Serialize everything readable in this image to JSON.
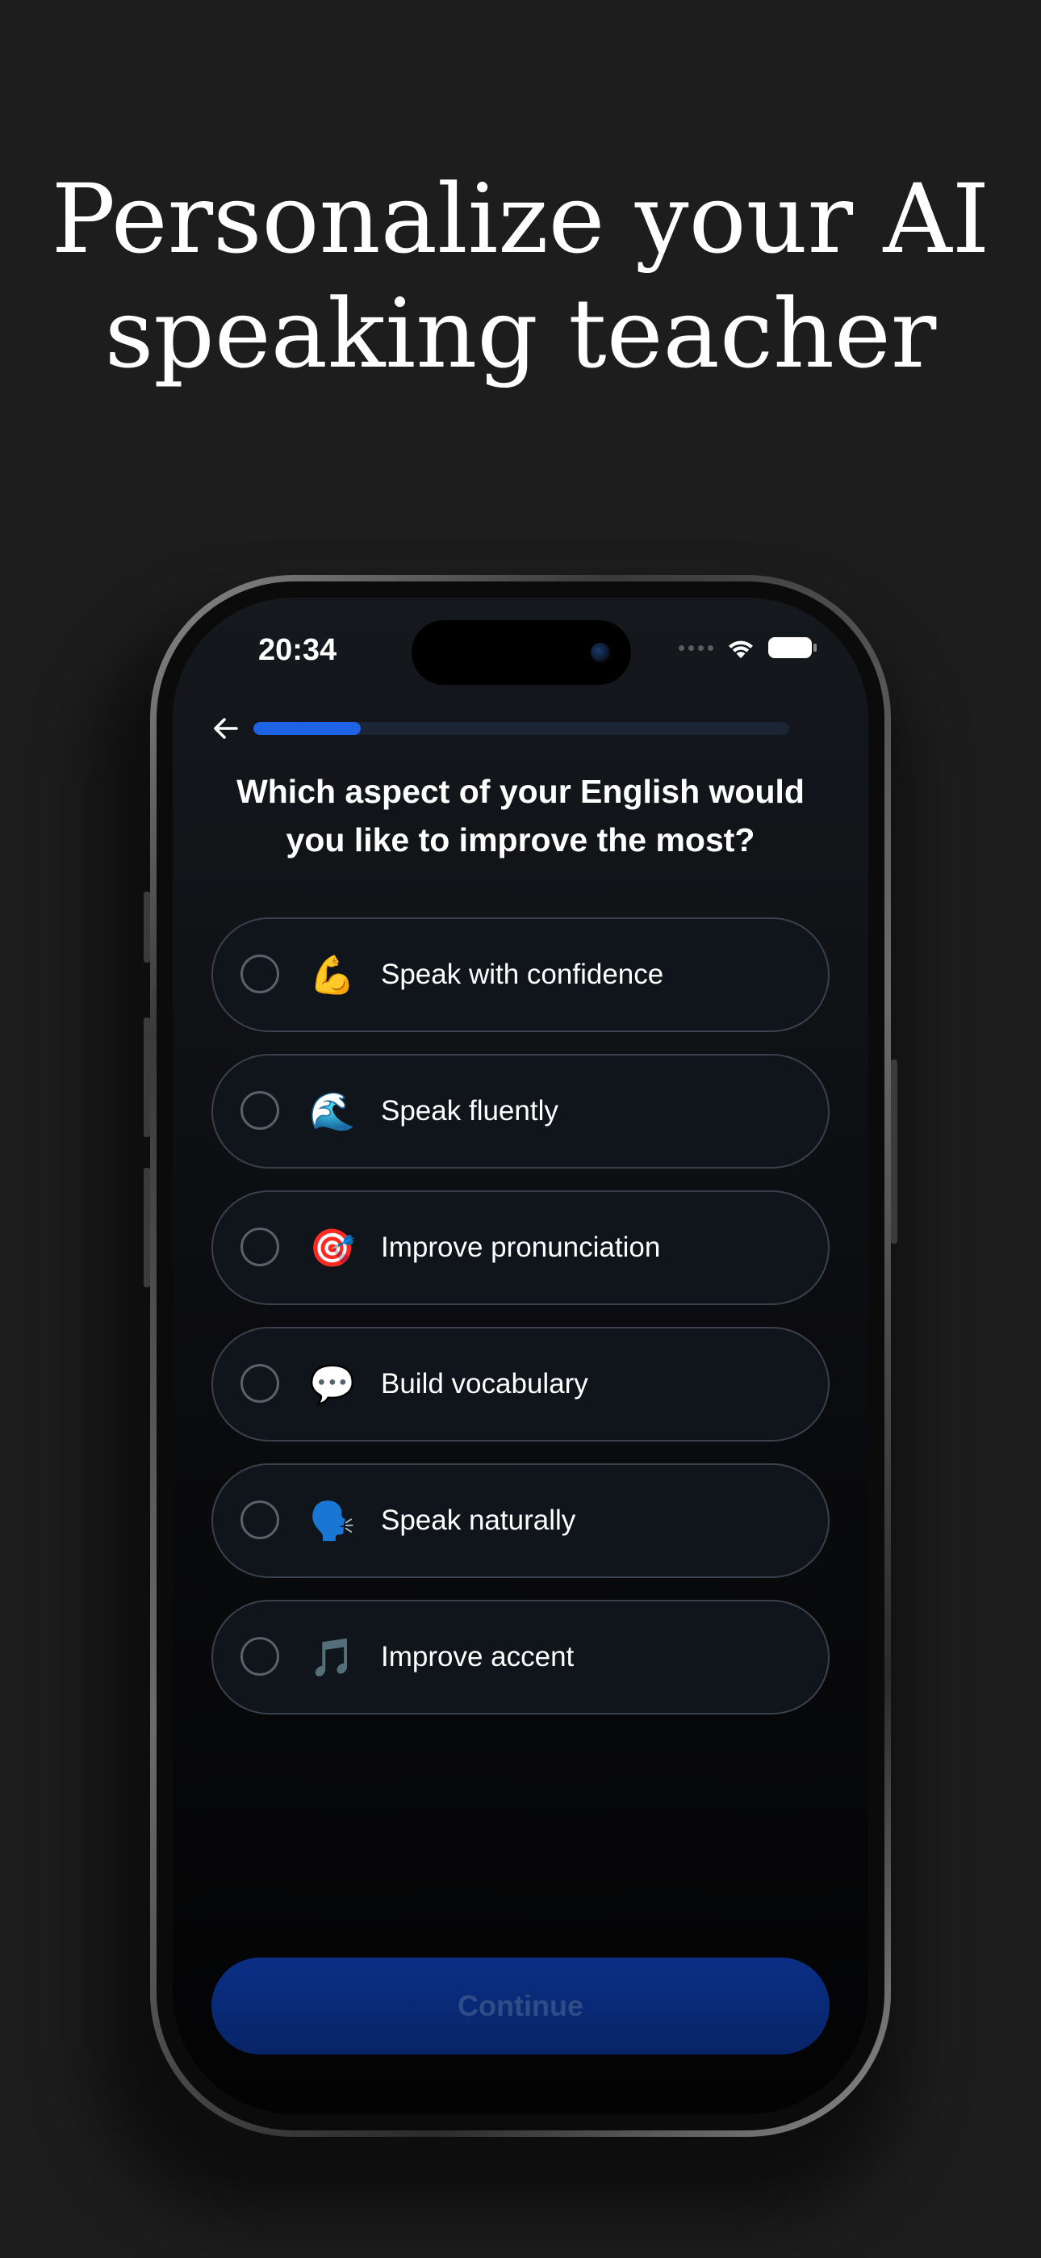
{
  "marketing": {
    "headline_line1": "Personalize your AI",
    "headline_line2": "speaking teacher"
  },
  "status_bar": {
    "time": "20:34",
    "icons": [
      "cellular-signal-icon",
      "wifi-icon",
      "battery-icon"
    ]
  },
  "header": {
    "back_icon": "arrow-left-icon",
    "progress_fraction": 0.2
  },
  "question": {
    "line1": "Which aspect of your English would",
    "line2": "you like to improve the most?"
  },
  "options": [
    {
      "emoji": "💪",
      "icon_name": "flexed-biceps-icon",
      "label": "Speak with confidence",
      "selected": false
    },
    {
      "emoji": "🌊",
      "icon_name": "water-wave-icon",
      "label": "Speak fluently",
      "selected": false
    },
    {
      "emoji": "🎯",
      "icon_name": "direct-hit-target-icon",
      "label": "Improve pronunciation",
      "selected": false
    },
    {
      "emoji": "💬",
      "icon_name": "speech-balloon-icon",
      "label": "Build vocabulary",
      "selected": false
    },
    {
      "emoji": "🗣️",
      "icon_name": "speaking-head-icon",
      "label": "Speak naturally",
      "selected": false
    },
    {
      "emoji": "🎵",
      "icon_name": "musical-note-icon",
      "label": "Improve accent",
      "selected": false
    }
  ],
  "continue": {
    "label": "Continue",
    "enabled": false
  },
  "colors": {
    "page_background": "#1d1d1d",
    "accent_blue": "#1e63e6",
    "continue_disabled_bg": "#0b2f86",
    "continue_disabled_text": "#2f4c86",
    "option_border": "#3a404c"
  }
}
